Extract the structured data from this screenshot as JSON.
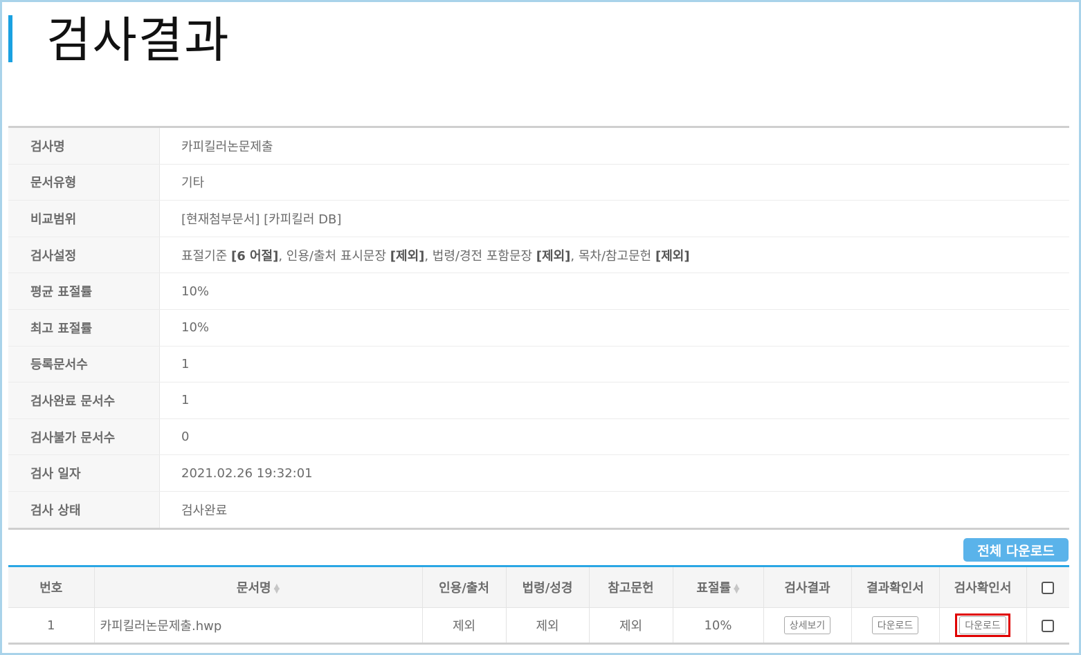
{
  "page": {
    "title": "검사결과"
  },
  "info": [
    {
      "label": "검사명",
      "value": "카피킬러논문제출"
    },
    {
      "label": "문서유형",
      "value": "기타"
    },
    {
      "label": "비교범위",
      "value": "[현재첨부문서] [카피킬러 DB]"
    },
    {
      "label": "검사설정",
      "value": null
    },
    {
      "label": "평균 표절률",
      "value": "10%"
    },
    {
      "label": "최고 표절률",
      "value": "10%"
    },
    {
      "label": "등록문서수",
      "value": "1"
    },
    {
      "label": "검사완료 문서수",
      "value": "1"
    },
    {
      "label": "검사불가 문서수",
      "value": "0"
    },
    {
      "label": "검사 일자",
      "value": "2021.02.26 19:32:01"
    },
    {
      "label": "검사 상태",
      "value": "검사완료"
    }
  ],
  "settings": {
    "p1": "표절기준 ",
    "b1": "[6 어절]",
    "p2": ", 인용/출처 표시문장 ",
    "b2": "[제외]",
    "p3": ", 법령/경전 포함문장 ",
    "b3": "[제외]",
    "p4": ", 목차/참고문헌 ",
    "b4": "[제외]"
  },
  "actions": {
    "download_all": "전체 다운로드"
  },
  "table": {
    "headers": [
      "번호",
      "문서명",
      "인용/출처",
      "법령/성경",
      "참고문헌",
      "표절률",
      "검사결과",
      "결과확인서",
      "검사확인서"
    ],
    "rows": [
      {
        "no": "1",
        "name": "카피킬러논문제출.hwp",
        "citation": "제외",
        "law": "제외",
        "reference": "제외",
        "rate": "10%",
        "result_btn": "상세보기",
        "report_btn": "다운로드",
        "certificate_btn": "다운로드"
      }
    ]
  },
  "icons": {
    "sort": "sort-icon",
    "checkbox": "checkbox"
  },
  "colors": {
    "accent": "#1aa1e1",
    "button": "#5ab3ea",
    "highlight": "#e00000"
  }
}
